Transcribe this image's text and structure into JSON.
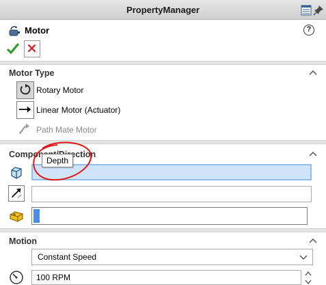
{
  "window": {
    "title": "PropertyManager"
  },
  "feature": {
    "title": "Motor"
  },
  "motor_type": {
    "header": "Motor Type",
    "options": [
      {
        "label": "Rotary Motor"
      },
      {
        "label": "Linear Motor (Actuator)"
      },
      {
        "label": "Path Mate Motor"
      }
    ]
  },
  "component_direction": {
    "header": "Component/Direction",
    "tooltip": "Depth"
  },
  "motion": {
    "header": "Motion",
    "type_selected": "Constant Speed",
    "speed_value": "100 RPM"
  },
  "colors": {
    "ok_green": "#2c9b2c",
    "cancel_red": "#d42020",
    "annotation_red": "#e01818",
    "selected_field": "#cfe4f8"
  }
}
